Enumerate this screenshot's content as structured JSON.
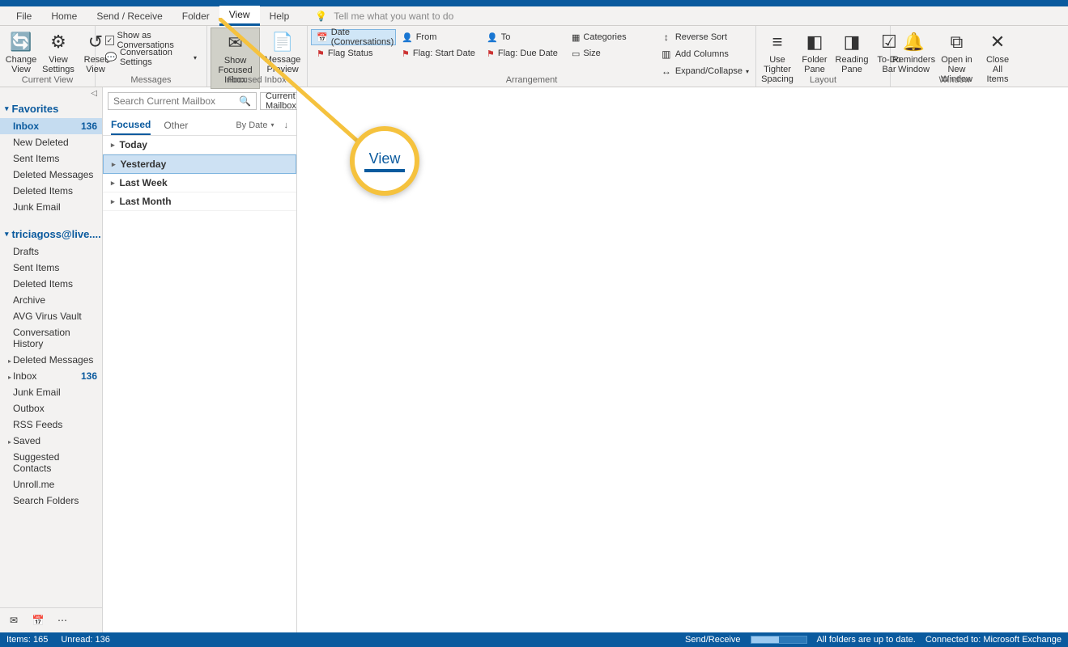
{
  "tabs": {
    "file": "File",
    "home": "Home",
    "sendrecv": "Send / Receive",
    "folder": "Folder",
    "view": "View",
    "help": "Help"
  },
  "tellme": "Tell me what you want to do",
  "ribbon": {
    "currentview": {
      "change": "Change View",
      "settings": "View Settings",
      "reset": "Reset View",
      "label": "Current View"
    },
    "messages": {
      "showconv": "Show as Conversations",
      "convset": "Conversation Settings",
      "label": "Messages"
    },
    "focused": {
      "showfoc": "Show Focused Inbox",
      "msgprev": "Message Preview",
      "label": "Focused Inbox"
    },
    "arrangement": {
      "date": "Date (Conversations)",
      "from": "From",
      "to": "To",
      "categories": "Categories",
      "flagstatus": "Flag Status",
      "flagstart": "Flag: Start Date",
      "flagdue": "Flag: Due Date",
      "size": "Size",
      "reverse": "Reverse Sort",
      "addcols": "Add Columns",
      "expand": "Expand/Collapse",
      "label": "Arrangement"
    },
    "layout": {
      "tighter": "Use Tighter Spacing",
      "folderpane": "Folder Pane",
      "readingpane": "Reading Pane",
      "todobar": "To-Do Bar",
      "label": "Layout"
    },
    "window": {
      "reminders": "Reminders Window",
      "opennew": "Open in New Window",
      "closeall": "Close All Items",
      "label": "Window"
    }
  },
  "nav": {
    "favorites": "Favorites",
    "fav_items": [
      {
        "label": "Inbox",
        "count": "136",
        "sel": true
      },
      {
        "label": "New Deleted"
      },
      {
        "label": "Sent Items"
      },
      {
        "label": "Deleted Messages"
      },
      {
        "label": "Deleted Items"
      },
      {
        "label": "Junk Email"
      }
    ],
    "account": "triciagoss@live....",
    "acct_items": [
      {
        "label": "Drafts"
      },
      {
        "label": "Sent Items"
      },
      {
        "label": "Deleted Items"
      },
      {
        "label": "Archive"
      },
      {
        "label": "AVG Virus Vault"
      },
      {
        "label": "Conversation History"
      },
      {
        "label": "Deleted Messages",
        "exp": true
      },
      {
        "label": "Inbox",
        "count": "136",
        "exp": true
      },
      {
        "label": "Junk Email"
      },
      {
        "label": "Outbox"
      },
      {
        "label": "RSS Feeds"
      },
      {
        "label": "Saved",
        "exp": true
      },
      {
        "label": "Suggested Contacts"
      },
      {
        "label": "Unroll.me"
      },
      {
        "label": "Search Folders"
      }
    ]
  },
  "search": {
    "placeholder": "Search Current Mailbox",
    "scope": "Current Mailbox"
  },
  "pivot": {
    "focused": "Focused",
    "other": "Other",
    "sort": "By Date"
  },
  "groups": [
    "Today",
    "Yesterday",
    "Last Week",
    "Last Month"
  ],
  "callout": "View",
  "status": {
    "items": "Items: 165",
    "unread": "Unread: 136",
    "sendrecv": "Send/Receive",
    "uptodate": "All folders are up to date.",
    "connected": "Connected to: Microsoft Exchange"
  }
}
